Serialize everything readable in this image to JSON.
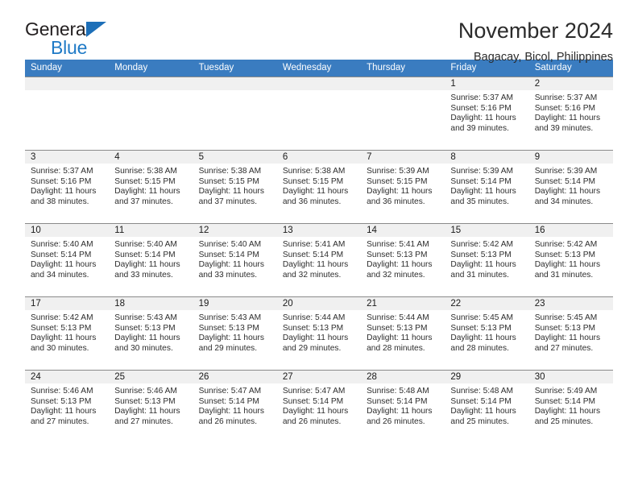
{
  "brand": {
    "name_part1": "General",
    "name_part2": "Blue",
    "triangle_color": "#1d6fb8",
    "blue_color": "#1f7ac6"
  },
  "header": {
    "month_title": "November 2024",
    "location": "Bagacay, Bicol, Philippines"
  },
  "theme": {
    "header_blue": "#3a7cc0",
    "daynum_band": "#f0f0f0",
    "row_divider": "#8a8a8a"
  },
  "calendar": {
    "weekdays": [
      "Sunday",
      "Monday",
      "Tuesday",
      "Wednesday",
      "Thursday",
      "Friday",
      "Saturday"
    ],
    "weeks": [
      [
        {
          "day": "",
          "sunrise": "",
          "sunset": "",
          "daylight_line1": "",
          "daylight_line2": "",
          "empty": true
        },
        {
          "day": "",
          "sunrise": "",
          "sunset": "",
          "daylight_line1": "",
          "daylight_line2": "",
          "empty": true
        },
        {
          "day": "",
          "sunrise": "",
          "sunset": "",
          "daylight_line1": "",
          "daylight_line2": "",
          "empty": true
        },
        {
          "day": "",
          "sunrise": "",
          "sunset": "",
          "daylight_line1": "",
          "daylight_line2": "",
          "empty": true
        },
        {
          "day": "",
          "sunrise": "",
          "sunset": "",
          "daylight_line1": "",
          "daylight_line2": "",
          "empty": true
        },
        {
          "day": "1",
          "sunrise": "Sunrise: 5:37 AM",
          "sunset": "Sunset: 5:16 PM",
          "daylight_line1": "Daylight: 11 hours",
          "daylight_line2": "and 39 minutes."
        },
        {
          "day": "2",
          "sunrise": "Sunrise: 5:37 AM",
          "sunset": "Sunset: 5:16 PM",
          "daylight_line1": "Daylight: 11 hours",
          "daylight_line2": "and 39 minutes."
        }
      ],
      [
        {
          "day": "3",
          "sunrise": "Sunrise: 5:37 AM",
          "sunset": "Sunset: 5:16 PM",
          "daylight_line1": "Daylight: 11 hours",
          "daylight_line2": "and 38 minutes."
        },
        {
          "day": "4",
          "sunrise": "Sunrise: 5:38 AM",
          "sunset": "Sunset: 5:15 PM",
          "daylight_line1": "Daylight: 11 hours",
          "daylight_line2": "and 37 minutes."
        },
        {
          "day": "5",
          "sunrise": "Sunrise: 5:38 AM",
          "sunset": "Sunset: 5:15 PM",
          "daylight_line1": "Daylight: 11 hours",
          "daylight_line2": "and 37 minutes."
        },
        {
          "day": "6",
          "sunrise": "Sunrise: 5:38 AM",
          "sunset": "Sunset: 5:15 PM",
          "daylight_line1": "Daylight: 11 hours",
          "daylight_line2": "and 36 minutes."
        },
        {
          "day": "7",
          "sunrise": "Sunrise: 5:39 AM",
          "sunset": "Sunset: 5:15 PM",
          "daylight_line1": "Daylight: 11 hours",
          "daylight_line2": "and 36 minutes."
        },
        {
          "day": "8",
          "sunrise": "Sunrise: 5:39 AM",
          "sunset": "Sunset: 5:14 PM",
          "daylight_line1": "Daylight: 11 hours",
          "daylight_line2": "and 35 minutes."
        },
        {
          "day": "9",
          "sunrise": "Sunrise: 5:39 AM",
          "sunset": "Sunset: 5:14 PM",
          "daylight_line1": "Daylight: 11 hours",
          "daylight_line2": "and 34 minutes."
        }
      ],
      [
        {
          "day": "10",
          "sunrise": "Sunrise: 5:40 AM",
          "sunset": "Sunset: 5:14 PM",
          "daylight_line1": "Daylight: 11 hours",
          "daylight_line2": "and 34 minutes."
        },
        {
          "day": "11",
          "sunrise": "Sunrise: 5:40 AM",
          "sunset": "Sunset: 5:14 PM",
          "daylight_line1": "Daylight: 11 hours",
          "daylight_line2": "and 33 minutes."
        },
        {
          "day": "12",
          "sunrise": "Sunrise: 5:40 AM",
          "sunset": "Sunset: 5:14 PM",
          "daylight_line1": "Daylight: 11 hours",
          "daylight_line2": "and 33 minutes."
        },
        {
          "day": "13",
          "sunrise": "Sunrise: 5:41 AM",
          "sunset": "Sunset: 5:14 PM",
          "daylight_line1": "Daylight: 11 hours",
          "daylight_line2": "and 32 minutes."
        },
        {
          "day": "14",
          "sunrise": "Sunrise: 5:41 AM",
          "sunset": "Sunset: 5:13 PM",
          "daylight_line1": "Daylight: 11 hours",
          "daylight_line2": "and 32 minutes."
        },
        {
          "day": "15",
          "sunrise": "Sunrise: 5:42 AM",
          "sunset": "Sunset: 5:13 PM",
          "daylight_line1": "Daylight: 11 hours",
          "daylight_line2": "and 31 minutes."
        },
        {
          "day": "16",
          "sunrise": "Sunrise: 5:42 AM",
          "sunset": "Sunset: 5:13 PM",
          "daylight_line1": "Daylight: 11 hours",
          "daylight_line2": "and 31 minutes."
        }
      ],
      [
        {
          "day": "17",
          "sunrise": "Sunrise: 5:42 AM",
          "sunset": "Sunset: 5:13 PM",
          "daylight_line1": "Daylight: 11 hours",
          "daylight_line2": "and 30 minutes."
        },
        {
          "day": "18",
          "sunrise": "Sunrise: 5:43 AM",
          "sunset": "Sunset: 5:13 PM",
          "daylight_line1": "Daylight: 11 hours",
          "daylight_line2": "and 30 minutes."
        },
        {
          "day": "19",
          "sunrise": "Sunrise: 5:43 AM",
          "sunset": "Sunset: 5:13 PM",
          "daylight_line1": "Daylight: 11 hours",
          "daylight_line2": "and 29 minutes."
        },
        {
          "day": "20",
          "sunrise": "Sunrise: 5:44 AM",
          "sunset": "Sunset: 5:13 PM",
          "daylight_line1": "Daylight: 11 hours",
          "daylight_line2": "and 29 minutes."
        },
        {
          "day": "21",
          "sunrise": "Sunrise: 5:44 AM",
          "sunset": "Sunset: 5:13 PM",
          "daylight_line1": "Daylight: 11 hours",
          "daylight_line2": "and 28 minutes."
        },
        {
          "day": "22",
          "sunrise": "Sunrise: 5:45 AM",
          "sunset": "Sunset: 5:13 PM",
          "daylight_line1": "Daylight: 11 hours",
          "daylight_line2": "and 28 minutes."
        },
        {
          "day": "23",
          "sunrise": "Sunrise: 5:45 AM",
          "sunset": "Sunset: 5:13 PM",
          "daylight_line1": "Daylight: 11 hours",
          "daylight_line2": "and 27 minutes."
        }
      ],
      [
        {
          "day": "24",
          "sunrise": "Sunrise: 5:46 AM",
          "sunset": "Sunset: 5:13 PM",
          "daylight_line1": "Daylight: 11 hours",
          "daylight_line2": "and 27 minutes."
        },
        {
          "day": "25",
          "sunrise": "Sunrise: 5:46 AM",
          "sunset": "Sunset: 5:13 PM",
          "daylight_line1": "Daylight: 11 hours",
          "daylight_line2": "and 27 minutes."
        },
        {
          "day": "26",
          "sunrise": "Sunrise: 5:47 AM",
          "sunset": "Sunset: 5:14 PM",
          "daylight_line1": "Daylight: 11 hours",
          "daylight_line2": "and 26 minutes."
        },
        {
          "day": "27",
          "sunrise": "Sunrise: 5:47 AM",
          "sunset": "Sunset: 5:14 PM",
          "daylight_line1": "Daylight: 11 hours",
          "daylight_line2": "and 26 minutes."
        },
        {
          "day": "28",
          "sunrise": "Sunrise: 5:48 AM",
          "sunset": "Sunset: 5:14 PM",
          "daylight_line1": "Daylight: 11 hours",
          "daylight_line2": "and 26 minutes."
        },
        {
          "day": "29",
          "sunrise": "Sunrise: 5:48 AM",
          "sunset": "Sunset: 5:14 PM",
          "daylight_line1": "Daylight: 11 hours",
          "daylight_line2": "and 25 minutes."
        },
        {
          "day": "30",
          "sunrise": "Sunrise: 5:49 AM",
          "sunset": "Sunset: 5:14 PM",
          "daylight_line1": "Daylight: 11 hours",
          "daylight_line2": "and 25 minutes."
        }
      ]
    ]
  }
}
